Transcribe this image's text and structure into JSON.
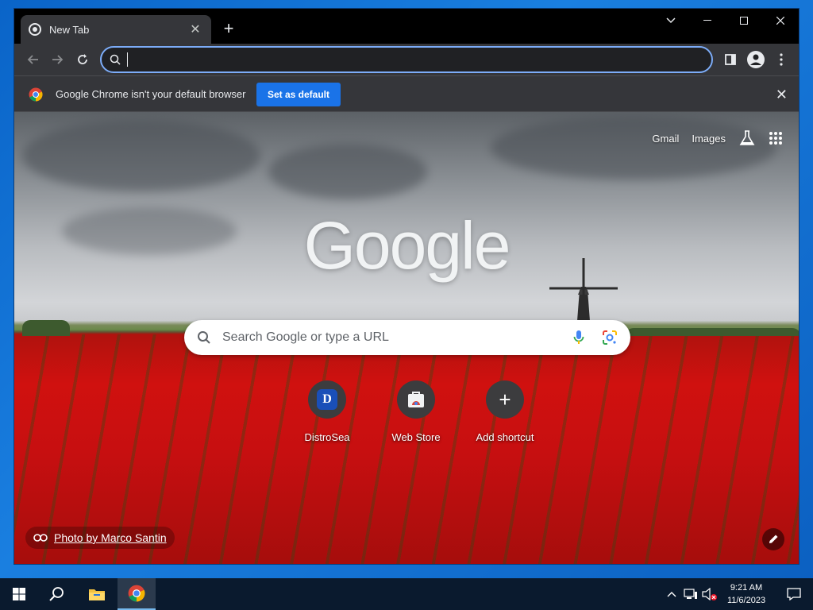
{
  "browser": {
    "tab_title": "New Tab",
    "omnibox_value": "",
    "infobar_message": "Google Chrome isn't your default browser",
    "set_default_label": "Set as default"
  },
  "ntp": {
    "logo_text": "Google",
    "top_links": {
      "gmail": "Gmail",
      "images": "Images"
    },
    "search_placeholder": "Search Google or type a URL",
    "shortcuts": [
      {
        "label": "DistroSea",
        "icon": "D"
      },
      {
        "label": "Web Store",
        "icon": "web-store-icon"
      },
      {
        "label": "Add shortcut",
        "icon": "+"
      }
    ],
    "attribution": "Photo by Marco Santin"
  },
  "taskbar": {
    "time": "9:21 AM",
    "date": "11/6/2023"
  },
  "colors": {
    "accent": "#1a73e8",
    "omnibox_focus": "#7cacf8",
    "toolbar": "#35363a"
  }
}
